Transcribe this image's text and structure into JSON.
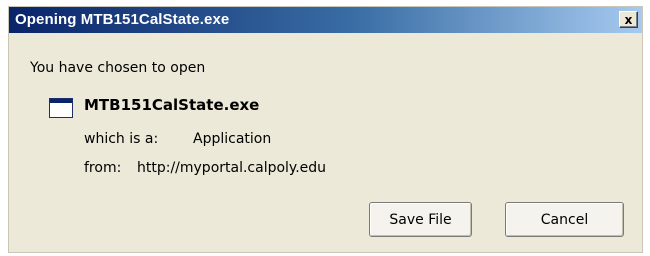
{
  "dialog": {
    "title": "Opening MTB151CalState.exe",
    "close_glyph": "x",
    "intro": "You have chosen to open",
    "file": {
      "icon": "application-window-icon",
      "name": "MTB151CalState.exe"
    },
    "type_label": "which is a:",
    "type_value": "Application",
    "from_label": "from:",
    "from_value": "http://myportal.calpoly.edu",
    "buttons": {
      "save": "Save File",
      "cancel": "Cancel"
    }
  },
  "colors": {
    "titlebar_start": "#0a246a",
    "titlebar_end": "#a6caf0",
    "dialog_bg": "#ece9d8"
  }
}
